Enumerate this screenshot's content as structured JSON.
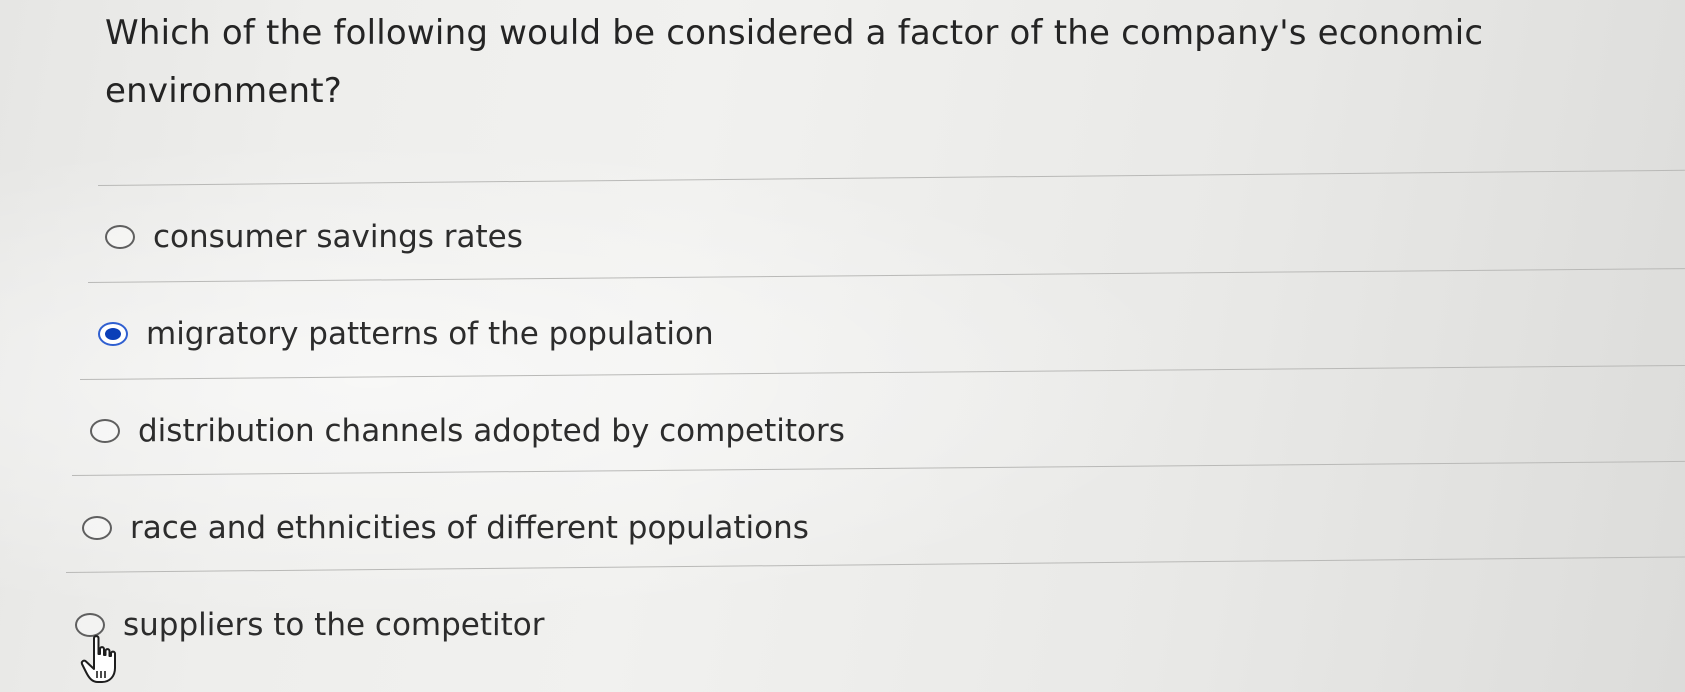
{
  "question": {
    "text": "Which of the following would be considered a factor of the company's economic environment?"
  },
  "options": [
    {
      "label": "consumer savings rates",
      "selected": false
    },
    {
      "label": "migratory patterns of the population",
      "selected": true
    },
    {
      "label": "distribution channels adopted by competitors",
      "selected": false
    },
    {
      "label": "race and ethnicities of different populations",
      "selected": false
    },
    {
      "label": "suppliers to the competitor",
      "selected": false
    }
  ],
  "colors": {
    "selected_radio": "#0b3fb8",
    "text": "#2c2c2c",
    "divider": "#b9b9b7"
  },
  "icons": {
    "cursor": "hand-pointer-icon"
  }
}
